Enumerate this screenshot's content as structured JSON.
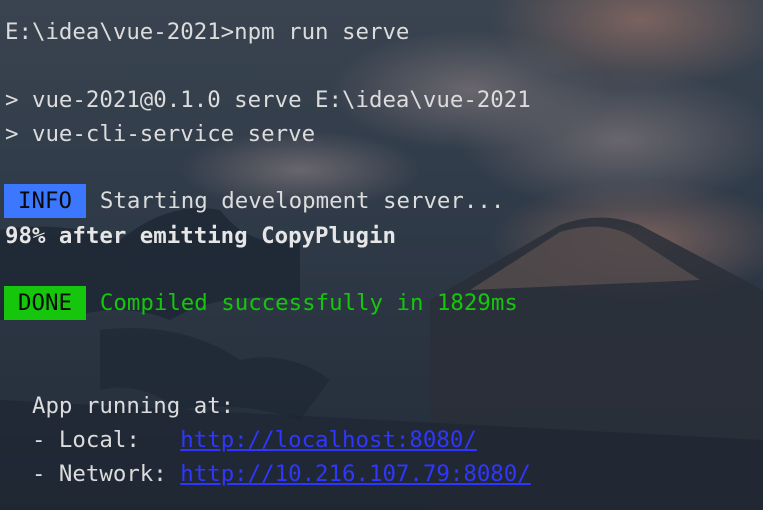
{
  "terminal": {
    "command_line": "E:\\idea\\vue-2021>npm run serve",
    "script_line_1": "> vue-2021@0.1.0 serve E:\\idea\\vue-2021",
    "script_line_2": "> vue-cli-service serve",
    "info_badge": "INFO",
    "info_text": "Starting development server...",
    "progress_text": "98% after emitting CopyPlugin",
    "done_badge": "DONE",
    "done_text": "Compiled successfully in 1829ms",
    "app_running": "  App running at:",
    "local_label": "  - Local:   ",
    "local_url": "http://localhost:8080/",
    "network_label": "  - Network: ",
    "network_url": "http://10.216.107.79:8080/"
  },
  "colors": {
    "info_badge_bg": "#3b78ff",
    "done_badge_bg": "#16c60c",
    "success_text": "#16c60c",
    "link": "#2f36ff"
  }
}
